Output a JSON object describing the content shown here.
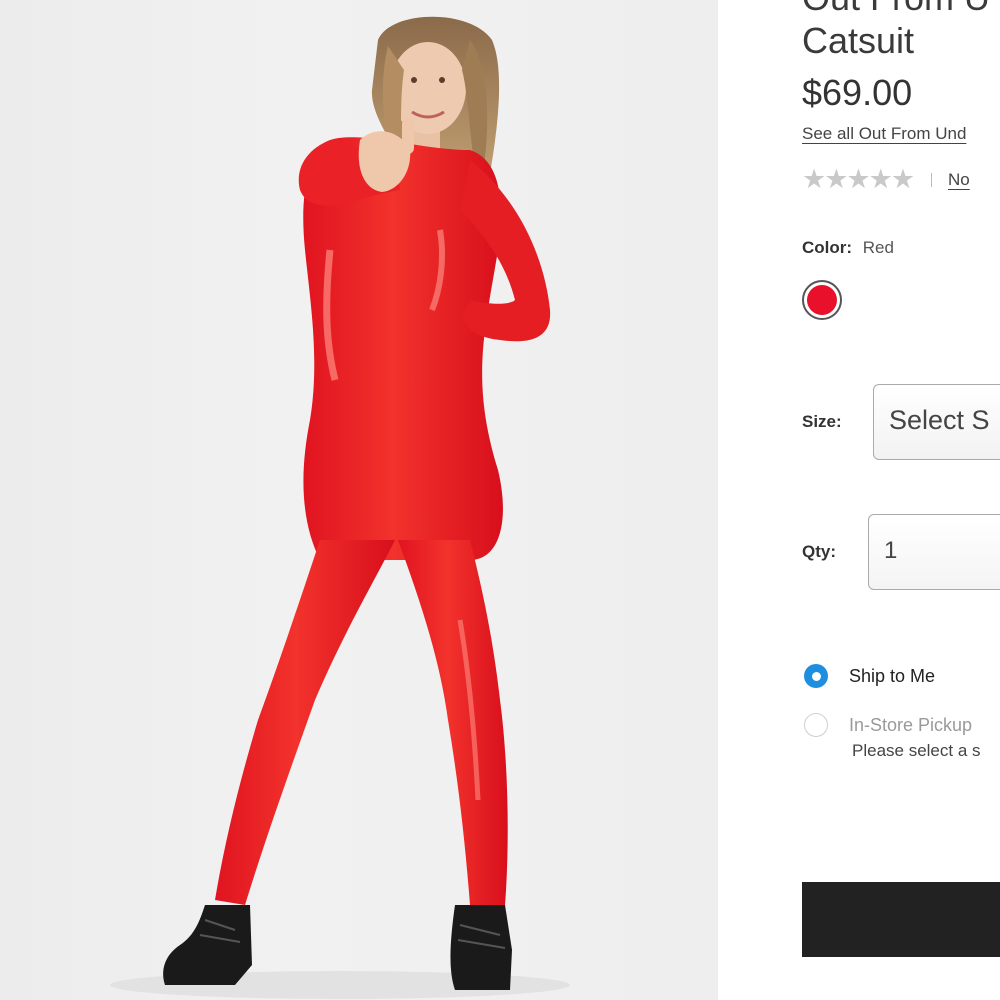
{
  "product": {
    "title_line1": "Out From U",
    "title_line2": "Catsuit",
    "price": "$69.00",
    "brand_link": "See all Out From Und",
    "rating": {
      "stars": "★★★★★",
      "reviews_link": "No"
    }
  },
  "color": {
    "label": "Color:",
    "value": "Red",
    "swatch_color": "#e8102a"
  },
  "size": {
    "label": "Size:",
    "select_value": "Select S"
  },
  "quantity": {
    "label": "Qty:",
    "value": "1"
  },
  "fulfillment": {
    "options": [
      {
        "label": "Ship to Me",
        "selected": true
      },
      {
        "label": "In-Store Pickup",
        "selected": false
      }
    ],
    "pickup_note": "Please select a s"
  },
  "colors": {
    "accent_blue": "#1e8fe0",
    "button_dark": "#222222",
    "catsuit_red": "#e8102a"
  }
}
